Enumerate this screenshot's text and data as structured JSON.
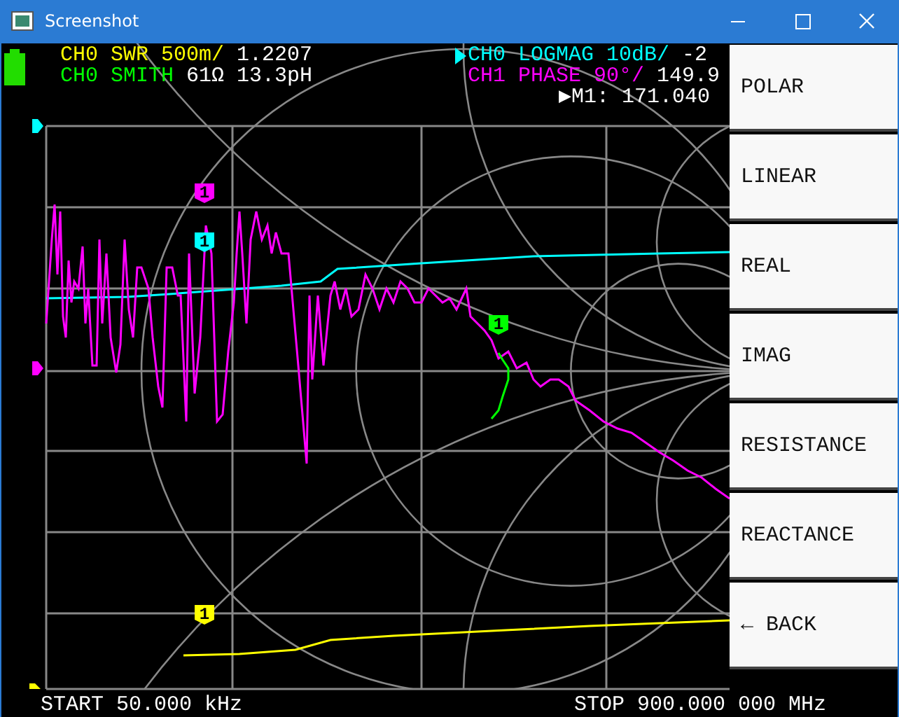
{
  "window": {
    "title": "Screenshot"
  },
  "traces_left": [
    {
      "label": "CH0 SWR 500m/",
      "value": "1.2207",
      "color": "#ffff00"
    },
    {
      "label": "CH0 SMITH",
      "value": "61Ω 13.3pH",
      "color": "#00ff00"
    }
  ],
  "traces_right": [
    {
      "label": "CH0 LOGMAG 10dB/",
      "value": "-2",
      "color": "#00ffff",
      "active": true
    },
    {
      "label": "CH1 PHASE 90°/",
      "value": "149.9",
      "color": "#ff00ff",
      "active": false
    }
  ],
  "marker_readout": {
    "pointer": "▶",
    "label": "M1:",
    "value": "171.040"
  },
  "trace_markers": [
    {
      "label": "1",
      "color": "#ff00ff"
    },
    {
      "label": "1",
      "color": "#00ffff"
    },
    {
      "label": "1",
      "color": "#00ff00"
    },
    {
      "label": "1",
      "color": "#ffff00"
    }
  ],
  "start": "START 50.000 kHz",
  "stop": "STOP 900.000 000 MHz",
  "menu": [
    {
      "label": "POLAR"
    },
    {
      "label": "LINEAR"
    },
    {
      "label": "REAL"
    },
    {
      "label": "IMAG"
    },
    {
      "label": "RESISTANCE"
    },
    {
      "label": "REACTANCE"
    },
    {
      "label": "← BACK"
    }
  ]
}
